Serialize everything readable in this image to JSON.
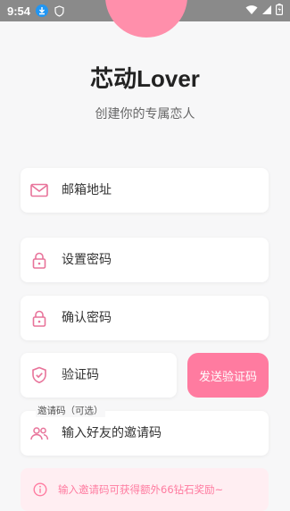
{
  "status_bar": {
    "time": "9:54"
  },
  "app": {
    "title": "芯动Lover",
    "subtitle": "创建你的专属恋人"
  },
  "form": {
    "email_placeholder": "邮箱地址",
    "password_placeholder": "设置密码",
    "confirm_placeholder": "确认密码",
    "code_placeholder": "验证码",
    "send_code_label": "发送验证码",
    "invite_label": "邀请码（可选）",
    "invite_placeholder": "输入好友的邀请码"
  },
  "tip": {
    "text": "输入邀请码可获得额外66钻石奖励~"
  },
  "colors": {
    "accent": "#ff7ba0",
    "logo": "#ff8fab",
    "tip_bg": "#ffeef2",
    "icon": "#e8739a"
  },
  "icons": [
    "download-icon",
    "shield-status-icon",
    "wifi-icon",
    "signal-icon",
    "battery-icon",
    "mail-icon",
    "lock-icon",
    "shield-check-icon",
    "users-icon",
    "info-icon"
  ]
}
